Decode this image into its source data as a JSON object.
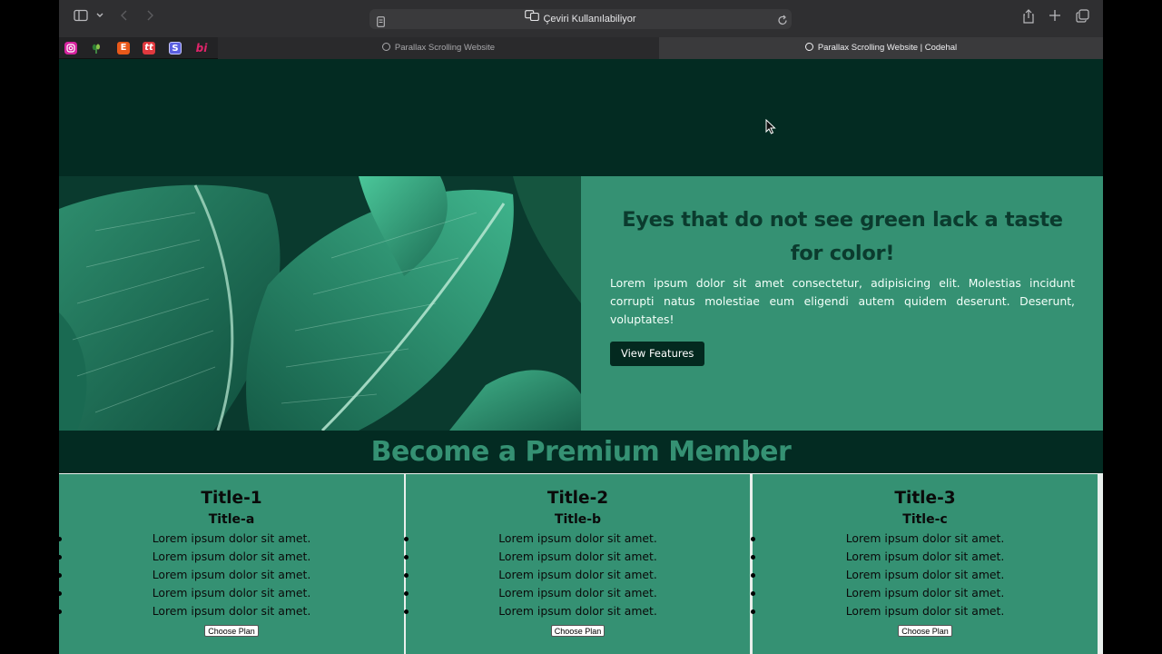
{
  "browser": {
    "address_text": "Çeviri Kullanılabiliyor",
    "bookmarks": [
      {
        "label": "",
        "icon": "instagram-icon",
        "color": "#d6249f"
      },
      {
        "label": "",
        "icon": "plant-icon",
        "color": "#2f7d32"
      },
      {
        "label": "E",
        "icon": "etsy-icon",
        "color": "#e8591a"
      },
      {
        "label": "tt",
        "icon": "tt-icon",
        "color": "#e0393e"
      },
      {
        "label": "S",
        "icon": "s-icon",
        "color": "#5a5fe0"
      },
      {
        "label": "bi",
        "icon": "bi-icon",
        "color": "#e0246a"
      }
    ],
    "tabs": [
      {
        "title": "Parallax Scrolling Website",
        "active": false
      },
      {
        "title": "Parallax Scrolling Website | Codehal",
        "active": true
      }
    ]
  },
  "feature": {
    "title": "Eyes that do not see green lack a taste for color!",
    "body": "Lorem ipsum dolor sit amet consectetur, adipisicing elit. Molestias incidunt corrupti natus molestiae eum eligendi autem quidem deserunt. Deserunt, voluptates!",
    "button_label": "View Features"
  },
  "premium": {
    "title": "Become a Premium Member"
  },
  "plans": [
    {
      "title": "Title-1",
      "subtitle": "Title-a",
      "items": [
        "Lorem ipsum dolor sit amet.",
        "Lorem ipsum dolor sit amet.",
        "Lorem ipsum dolor sit amet.",
        "Lorem ipsum dolor sit amet.",
        "Lorem ipsum dolor sit amet."
      ],
      "button_label": "Choose Plan"
    },
    {
      "title": "Title-2",
      "subtitle": "Title-b",
      "items": [
        "Lorem ipsum dolor sit amet.",
        "Lorem ipsum dolor sit amet.",
        "Lorem ipsum dolor sit amet.",
        "Lorem ipsum dolor sit amet.",
        "Lorem ipsum dolor sit amet."
      ],
      "button_label": "Choose Plan"
    },
    {
      "title": "Title-3",
      "subtitle": "Title-c",
      "items": [
        "Lorem ipsum dolor sit amet.",
        "Lorem ipsum dolor sit amet.",
        "Lorem ipsum dolor sit amet.",
        "Lorem ipsum dolor sit amet.",
        "Lorem ipsum dolor sit amet."
      ],
      "button_label": "Choose Plan"
    }
  ],
  "colors": {
    "dark_green": "#032b22",
    "accent_green": "#359173",
    "title_green": "#0b3b2e"
  }
}
